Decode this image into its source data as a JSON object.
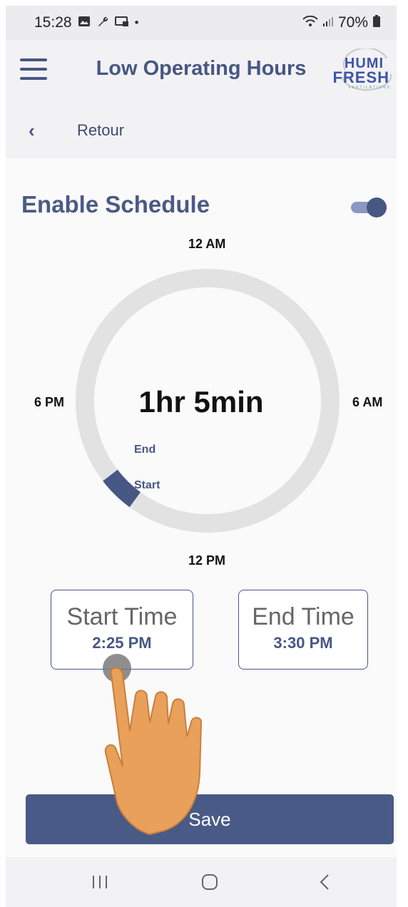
{
  "status_bar": {
    "time": "15:28",
    "battery": "70%",
    "icons": [
      "image-icon",
      "wrench-icon",
      "cast-icon",
      "dot-icon",
      "wifi-icon",
      "signal-icon",
      "battery-icon"
    ]
  },
  "app_bar": {
    "title": "Low Operating Hours",
    "menu_icon": "hamburger-icon",
    "logo_top": "HUMI",
    "logo_bottom": "FRESH",
    "logo_sub": "VENTILATIONS"
  },
  "back_bar": {
    "label": "Retour",
    "icon": "chevron-left-icon"
  },
  "schedule": {
    "enable_label": "Enable Schedule",
    "enabled": true,
    "dial": {
      "label_top": "12 AM",
      "label_right": "6 AM",
      "label_bottom": "12 PM",
      "label_left": "6 PM",
      "duration": "1hr 5min",
      "end_marker": "End",
      "start_marker": "Start",
      "track_color": "#e2e2e2",
      "active_color": "#475784"
    },
    "start_time": {
      "title": "Start Time",
      "value": "2:25 PM"
    },
    "end_time": {
      "title": "End Time",
      "value": "3:30 PM"
    },
    "save_label": "Save"
  },
  "nav_bar": {
    "icons": [
      "recent-apps-icon",
      "home-icon",
      "back-icon"
    ]
  },
  "colors": {
    "accent": "#475784",
    "save_button": "#4a5a86",
    "hand": "#e9a05a"
  }
}
